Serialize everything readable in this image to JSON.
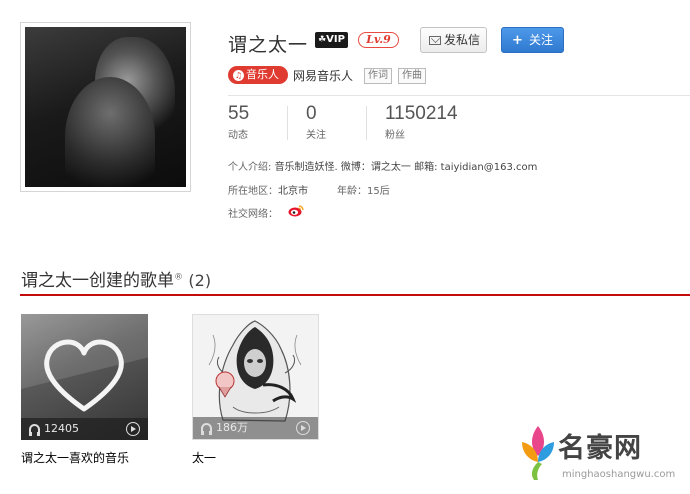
{
  "profile": {
    "name": "谓之太一",
    "vip_label": "VIP",
    "level_label": "Lv.9",
    "send_message_label": "发私信",
    "follow_label": "关注",
    "follow_plus": "+",
    "musician_badge": "音乐人",
    "musician_title": "网易音乐人",
    "tags": [
      "作词",
      "作曲"
    ]
  },
  "stats": [
    {
      "value": "55",
      "label": "动态"
    },
    {
      "value": "0",
      "label": "关注"
    },
    {
      "value": "1150214",
      "label": "粉丝"
    }
  ],
  "info": {
    "intro_label": "个人介绍:",
    "intro_value": "音乐制造妖怪. 微博：谓之太一 邮箱: taiyidian@163.com",
    "region_label": "所在地区：",
    "region_value": "北京市",
    "age_label": "年龄：",
    "age_value": "15后",
    "social_label": "社交网络："
  },
  "playlists_section": {
    "title": "谓之太一创建的歌单",
    "superscript": "®",
    "count": "(2)"
  },
  "playlists": [
    {
      "name": "谓之太一喜欢的音乐",
      "plays": "12405"
    },
    {
      "name": "太一",
      "plays": "186万"
    }
  ],
  "watermark": {
    "text": "名豪网",
    "url": "minghaoshangwu.com"
  },
  "colors": {
    "accent_red": "#c20c0c",
    "follow_blue": "#2f79d0",
    "badge_red": "#e03b30"
  }
}
